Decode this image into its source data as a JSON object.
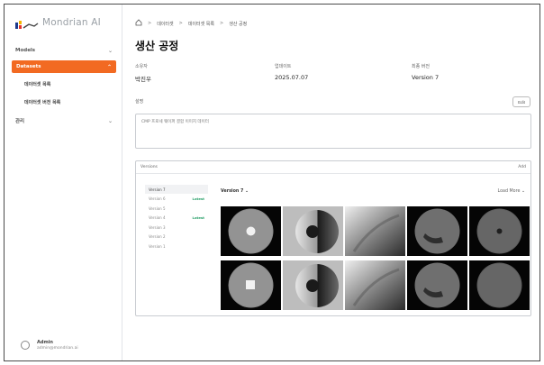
{
  "sidebar": {
    "logo_text": "Mondrian AI",
    "group_1_label": "Models",
    "active_label": "Datasets",
    "sub_items": [
      "데이터셋 목록",
      "데이터셋 버전 목록"
    ],
    "group_2_label": "관리",
    "user": {
      "name": "Admin",
      "email": "admin@mondrian.ai"
    }
  },
  "breadcrumb": [
    "데이터셋",
    "데이터셋 목록",
    "생산 공정"
  ],
  "page_title": "생산 공정",
  "meta": [
    {
      "label": "소유자",
      "value": "박진우"
    },
    {
      "label": "업데이트",
      "value": "2025.07.07"
    },
    {
      "label": "최종 버전",
      "value": "Version 7"
    }
  ],
  "description": {
    "label": "설명",
    "edit_label": "Edit",
    "text": "CMP 프로세 웨이퍼 결함 이미지 데이터"
  },
  "versions": {
    "header_label": "Versions",
    "header_action": "Add",
    "items": [
      {
        "label": "Version 7",
        "badge": "",
        "selected": true
      },
      {
        "label": "Version 6",
        "badge": "Latest",
        "selected": false
      },
      {
        "label": "Version 5",
        "badge": "",
        "selected": false
      },
      {
        "label": "Version 4",
        "badge": "Latest",
        "selected": false
      },
      {
        "label": "Version 3",
        "badge": "",
        "selected": false
      },
      {
        "label": "Version 2",
        "badge": "",
        "selected": false
      },
      {
        "label": "Version 1",
        "badge": "",
        "selected": false
      }
    ],
    "gallery_label": "Version 7",
    "gallery_action": "Load More"
  },
  "colors": {
    "accent": "#f26a22",
    "badge": "#2aa06a"
  }
}
